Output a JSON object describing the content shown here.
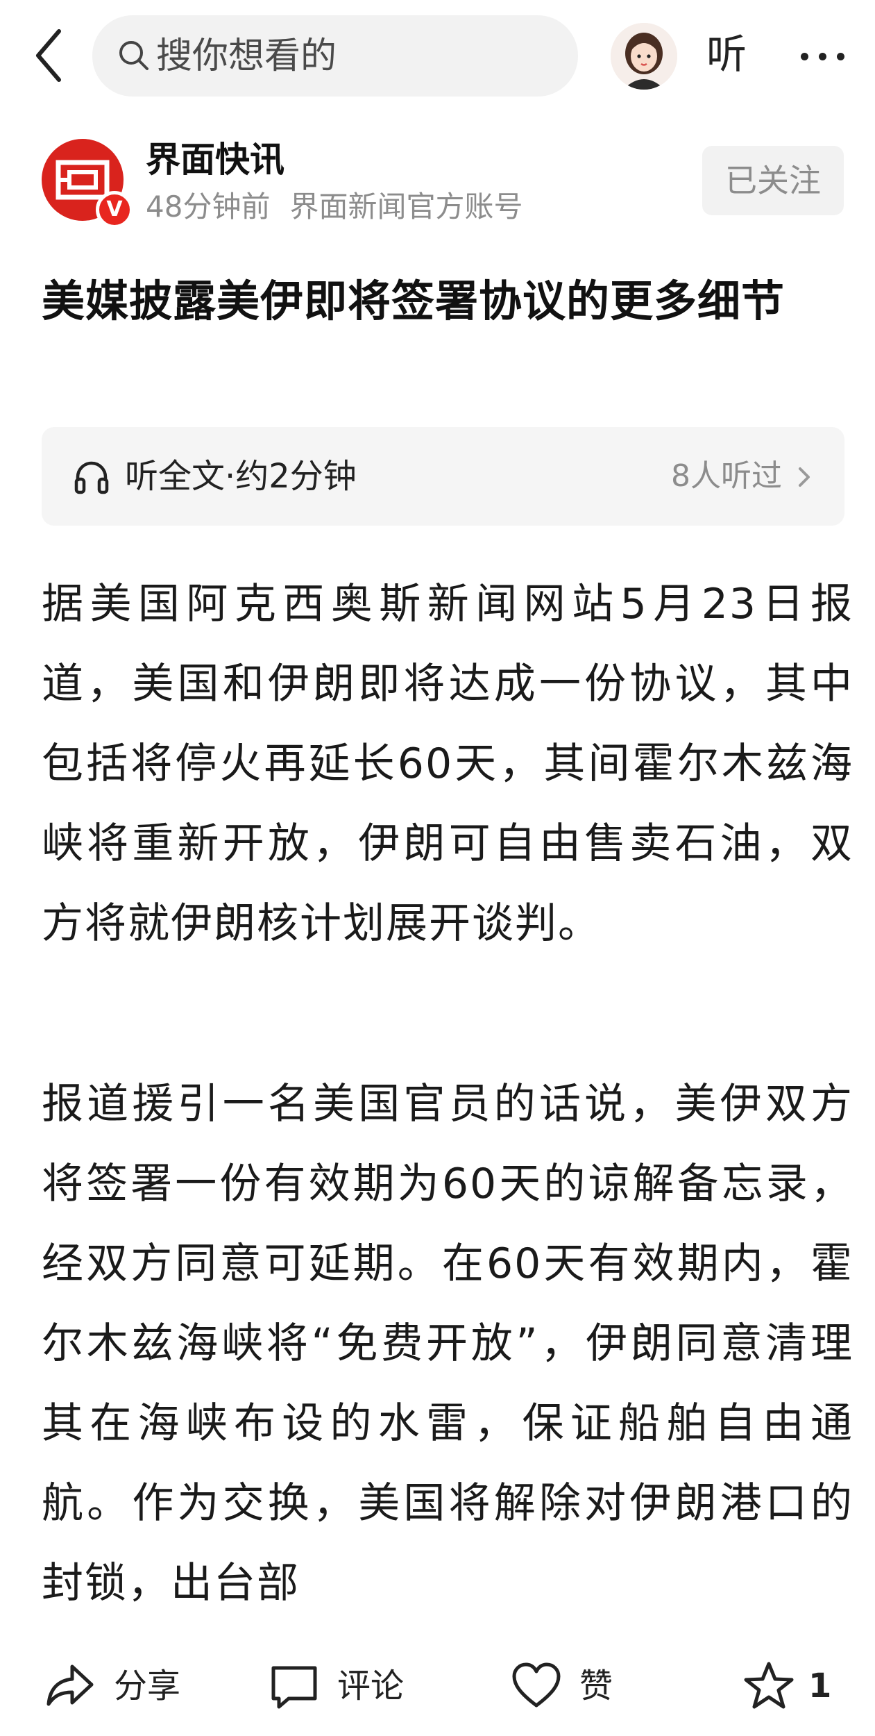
{
  "header": {
    "search_placeholder": "搜你想看的",
    "listen_label": "听"
  },
  "author": {
    "name": "界面快讯",
    "time": "48分钟前",
    "description": "界面新闻官方账号",
    "badge": "V",
    "follow_label": "已关注"
  },
  "article": {
    "title": "美媒披露美伊即将签署协议的更多细节",
    "listen": {
      "label": "听全文·约2分钟",
      "count": "8人听过"
    },
    "paragraphs": [
      "据美国阿克西奥斯新闻网站5月23日报道，美国和伊朗即将达成一份协议，其中包括将停火再延长60天，其间霍尔木兹海峡将重新开放，伊朗可自由售卖石油，双方将就伊朗核计划展开谈判。",
      "报道援引一名美国官员的话说，美伊双方将签署一份有效期为60天的谅解备忘录，经双方同意可延期。在60天有效期内，霍尔木兹海峡将“免费开放”，伊朗同意清理其在海峡布设的水雷，保证船舶自由通航。作为交换，美国将解除对伊朗港口的封锁，出台部"
    ]
  },
  "actions": {
    "share": "分享",
    "comment": "评论",
    "like": "赞",
    "favorite_count": "1"
  },
  "colors": {
    "brand_red": "#d9231d",
    "muted_text": "#8c8c8c",
    "chip_bg": "#f2f2f2"
  }
}
